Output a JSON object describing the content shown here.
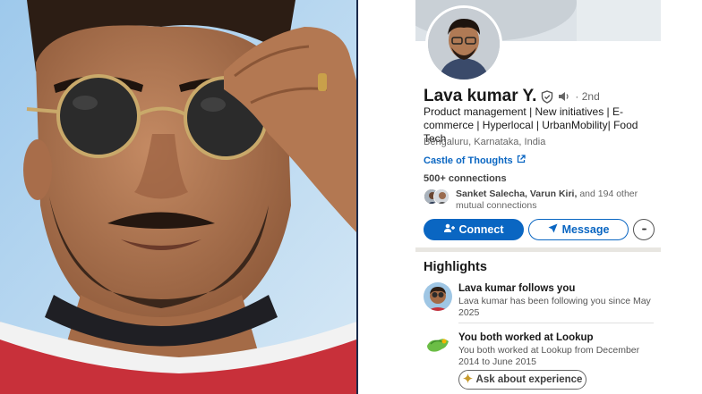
{
  "profile": {
    "name": "Lava kumar Y.",
    "degree": "· 2nd",
    "headline": "Product management | New initiatives | E-commerce | Hyperlocal | UrbanMobility| Food Tech",
    "location": "Bengaluru, Karnataka, India",
    "website": "Castle of Thoughts",
    "connections": "500+ connections",
    "mutual": {
      "names": "Sanket Salecha, Varun Kiri,",
      "rest": "and 194 other mutual connections"
    }
  },
  "actions": {
    "connect_label": "Connect",
    "message_label": "Message",
    "more_label": "•••"
  },
  "highlights": {
    "title": "Highlights",
    "items": [
      {
        "heading": "Lava kumar follows you",
        "description": "Lava kumar has been following you since May 2025",
        "icon": "profile-avatar-icon"
      },
      {
        "heading": "You both worked at Lookup",
        "description": "You both worked at Lookup from December 2014 to June 2015",
        "icon": "company-logo-icon"
      }
    ],
    "ask_label": "Ask about experience"
  },
  "colors": {
    "accent": "#0a66c2",
    "text": "#191919",
    "muted": "#666666"
  }
}
